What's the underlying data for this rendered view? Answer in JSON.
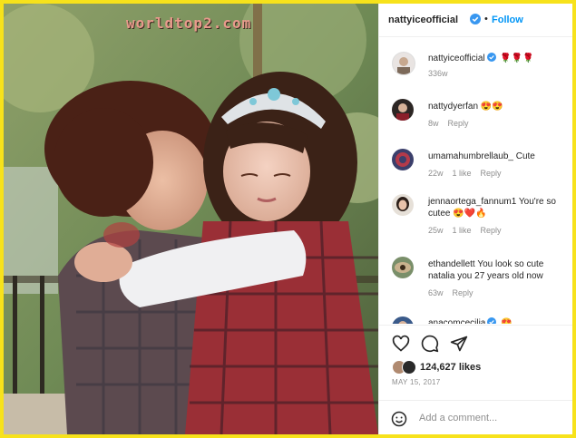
{
  "watermark": "worldtop2.com",
  "post": {
    "username": "nattyiceofficial",
    "follow_label": "Follow",
    "dot": "•",
    "image_alt": "photo of a woman hugging a little girl wearing a tiara and plaid dress"
  },
  "comments": [
    {
      "username": "nattyiceofficial",
      "verified": true,
      "text": "🌹🌹🌹",
      "age": "336w",
      "likes": "",
      "reply": ""
    },
    {
      "username": "nattydyerfan",
      "verified": false,
      "text": "😍😍",
      "age": "8w",
      "likes": "",
      "reply": "Reply"
    },
    {
      "username": "umamahumbrellaub_",
      "verified": false,
      "text": "Cute",
      "age": "22w",
      "likes": "1 like",
      "reply": "Reply"
    },
    {
      "username": "jennaortega_fannum1",
      "verified": false,
      "text": "You're so cutee 😍❤️🔥",
      "age": "25w",
      "likes": "1 like",
      "reply": "Reply"
    },
    {
      "username": "ethandellett",
      "verified": false,
      "text": "You look so cute natalia you 27 years old now",
      "age": "63w",
      "likes": "",
      "reply": "Reply"
    },
    {
      "username": "anacomcecilia",
      "verified": true,
      "text": "😍",
      "age": "",
      "likes": "",
      "reply": ""
    }
  ],
  "actions": {
    "likes_count": "124,627 likes",
    "date": "MAY 15, 2017",
    "icons": [
      "heart-icon",
      "comment-icon",
      "share-icon"
    ]
  },
  "add_comment": {
    "placeholder": "Add a comment...",
    "value": ""
  },
  "colors": {
    "border_frame": "#f7e21b",
    "link_blue": "#0095f6",
    "verified_blue": "#3897f0",
    "muted_text": "#8e8e8e",
    "primary_text": "#262626"
  }
}
